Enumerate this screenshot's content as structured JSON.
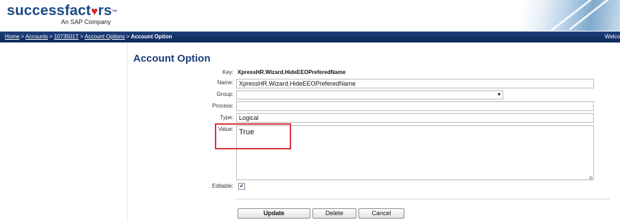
{
  "header": {
    "logo_text": "successfactors",
    "logo_tm": "™",
    "logo_sub": "An SAP Company"
  },
  "navbar": {
    "breadcrumbs": [
      {
        "label": "Home",
        "link": true
      },
      {
        "label": "Accounts",
        "link": true
      },
      {
        "label": "1073501T",
        "link": true
      },
      {
        "label": "Account Options",
        "link": true
      },
      {
        "label": "Account Option",
        "link": false
      }
    ],
    "separator": ">",
    "welcome": "Welco"
  },
  "main": {
    "title": "Account Option",
    "fields": {
      "key_label": "Key:",
      "key_value": "XpressHR.Wizard.HideEEOPreferedName",
      "name_label": "Name:",
      "name_value": "XpressHR.Wizard.HideEEOPreferedName",
      "group_label": "Group:",
      "group_value": "",
      "process_label": "Process:",
      "process_value": "",
      "type_label": "Type:",
      "type_value": "Logical",
      "value_label": "Value:",
      "value_value": "True",
      "editable_label": "Editable:",
      "editable_checked": true
    },
    "buttons": {
      "update": "Update",
      "delete": "Delete",
      "cancel": "Cancel"
    }
  },
  "colors": {
    "brand_blue": "#1a4a86",
    "nav_bg": "#0e2a5c",
    "title_blue": "#1a3d7a",
    "highlight_red": "#d9303a",
    "logo_heart": "#d22630"
  },
  "icons": [
    "dropdown-arrow-icon",
    "checkmark-icon",
    "resize-grip-icon"
  ]
}
